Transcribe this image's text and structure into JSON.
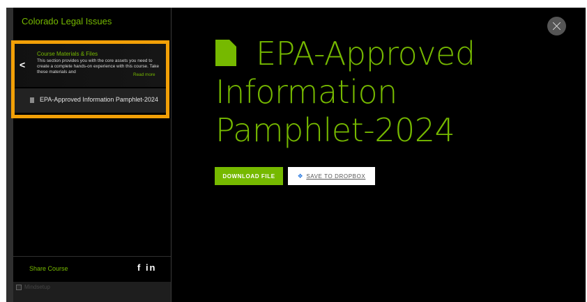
{
  "sidebar": {
    "course_title": "Colorado Legal Issues",
    "section": {
      "heading": "Course Materials & Files",
      "description": "This section provides you with the core assets you need to create a complete hands-on experience with this course. Take these materials and",
      "read_more": "Read more"
    },
    "file_item_label": "EPA-Approved Information Pamphlet-2024",
    "share_label": "Share Course",
    "social_icons": [
      "facebook-icon",
      "linkedin-icon"
    ],
    "social_text": "f in",
    "footer_image_alt": "Mindsetup"
  },
  "main": {
    "title": "EPA-Approved Information Pamphlet-2024",
    "download_label": "DOWNLOAD FILE",
    "dropbox_label": "SAVE TO DROPBOX"
  },
  "colors": {
    "accent": "#76b900",
    "highlight": "#f2a007",
    "background": "#000000",
    "dropbox": "#2f7de1"
  }
}
